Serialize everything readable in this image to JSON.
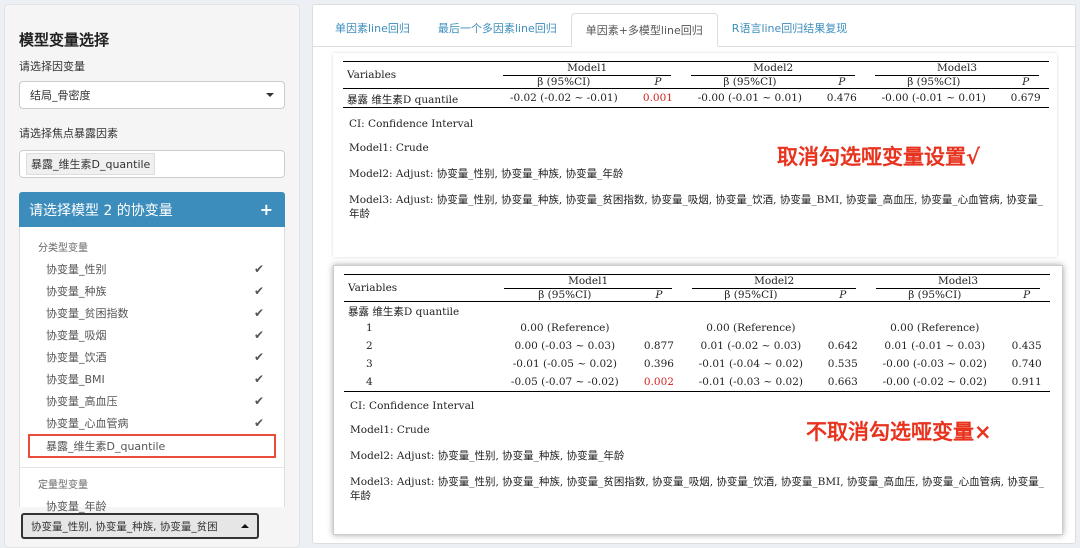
{
  "sidebar": {
    "title": "模型变量选择",
    "dep_label": "请选择因变量",
    "dep_value": "结局_骨密度",
    "exposure_label": "请选择焦点暴露因素",
    "exposure_tag": "暴露_维生素D_quantile",
    "cov_title": "请选择模型 2 的协变量",
    "cov_plus": "+",
    "cat_group": "分类型变量",
    "cat_items": [
      "协变量_性别",
      "协变量_种族",
      "协变量_贫困指数",
      "协变量_吸烟",
      "协变量_饮酒",
      "协变量_BMI",
      "协变量_高血压",
      "协变量_心血管病"
    ],
    "highlight_item": "暴露_维生素D_quantile",
    "num_group": "定量型变量",
    "num_items": [
      "协变量_年龄"
    ],
    "check_glyph": "✔",
    "bottom_select": "协变量_性别, 协变量_种族, 协变量_贫困"
  },
  "tabs": [
    "单因素line回归",
    "最后一个多因素line回归",
    "单因素+多模型line回归",
    "R语言line回归结果复现"
  ],
  "active_tab": 2,
  "table_common": {
    "variables": "Variables",
    "model1": "Model1",
    "model2": "Model2",
    "model3": "Model3",
    "beta": "β (95%CI)",
    "p": "P",
    "exposure": "暴露 维生素D quantile"
  },
  "table1": {
    "row": [
      "-0.02 (-0.02 ~ -0.01)",
      "0.001",
      "-0.00 (-0.01 ~ 0.01)",
      "0.476",
      "-0.00 (-0.01 ~ 0.01)",
      "0.679"
    ]
  },
  "table2": {
    "rows": [
      {
        "level": "1",
        "cells": [
          "0.00 (Reference)",
          "",
          "0.00 (Reference)",
          "",
          "0.00 (Reference)",
          ""
        ]
      },
      {
        "level": "2",
        "cells": [
          "0.00 (-0.03 ~ 0.03)",
          "0.877",
          "0.01 (-0.02 ~ 0.03)",
          "0.642",
          "0.01 (-0.01 ~ 0.03)",
          "0.435"
        ]
      },
      {
        "level": "3",
        "cells": [
          "-0.01 (-0.05 ~ 0.02)",
          "0.396",
          "-0.01 (-0.04 ~ 0.02)",
          "0.535",
          "-0.00 (-0.03 ~ 0.02)",
          "0.740"
        ]
      },
      {
        "level": "4",
        "cells": [
          "-0.05 (-0.07 ~ -0.02)",
          "0.002",
          "-0.01 (-0.03 ~ 0.02)",
          "0.663",
          "-0.00 (-0.02 ~ 0.02)",
          "0.911"
        ]
      }
    ]
  },
  "notes1": {
    "ci": "CI: Confidence Interval",
    "m1": "Model1: Crude",
    "m2": "Model2: Adjust: 协变量_性别, 协变量_种族, 协变量_年龄",
    "m3": "Model3: Adjust: 协变量_性别, 协变量_种族, 协变量_贫困指数, 协变量_吸烟, 协变量_饮酒, 协变量_BMI, 协变量_高血压, 协变量_心血管病, 协变量_年龄"
  },
  "notes2": {
    "ci": "CI: Confidence Interval",
    "m1": "Model1: Crude",
    "m2": "Model2: Adjust: 协变量_性别, 协变量_种族, 协变量_年龄",
    "m3": "Model3: Adjust: 协变量_性别, 协变量_种族, 协变量_贫困指数, 协变量_吸烟, 协变量_饮酒, 协变量_BMI, 协变量_高血压, 协变量_心血管病, 协变量_年龄"
  },
  "annotations": {
    "top": "取消勾选哑变量设置√",
    "bottom": "不取消勾选哑变量×"
  },
  "colors": {
    "accent": "#3c8dbc",
    "annotation": "#e8331f",
    "significant": "#d21f1f"
  }
}
